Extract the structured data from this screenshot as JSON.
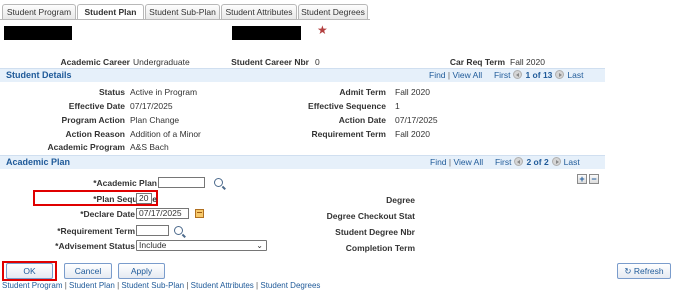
{
  "tabs": [
    {
      "label": "Student Program",
      "active": false
    },
    {
      "label": "Student Plan",
      "active": true
    },
    {
      "label": "Student Sub-Plan",
      "active": false
    },
    {
      "label": "Student Attributes",
      "active": false
    },
    {
      "label": "Student Degrees",
      "active": false
    }
  ],
  "header": {
    "required_marker": "★",
    "academic_career_label": "Academic Career",
    "academic_career_value": "Undergraduate",
    "student_career_nbr_label": "Student Career Nbr",
    "student_career_nbr_value": "0",
    "car_req_term_label": "Car Req Term",
    "car_req_term_value": "Fall 2020"
  },
  "student_details": {
    "title": "Student Details",
    "nav": {
      "find": "Find",
      "view_all": "View All",
      "first": "First",
      "count": "1 of 13",
      "last": "Last"
    },
    "status_label": "Status",
    "status_value": "Active in Program",
    "effective_date_label": "Effective Date",
    "effective_date_value": "07/17/2025",
    "program_action_label": "Program Action",
    "program_action_value": "Plan Change",
    "action_reason_label": "Action Reason",
    "action_reason_value": "Addition of a Minor",
    "academic_program_label": "Academic Program",
    "academic_program_value": "A&S Bach",
    "admit_term_label": "Admit Term",
    "admit_term_value": "Fall 2020",
    "effective_sequence_label": "Effective Sequence",
    "effective_sequence_value": "1",
    "action_date_label": "Action Date",
    "action_date_value": "07/17/2025",
    "requirement_term_label": "Requirement Term",
    "requirement_term_value": "Fall 2020"
  },
  "academic_plan": {
    "title": "Academic Plan",
    "nav": {
      "find": "Find",
      "view_all": "View All",
      "first": "First",
      "count": "2 of 2",
      "last": "Last"
    },
    "add_label": "+",
    "remove_label": "−",
    "academic_plan_label": "*Academic Plan",
    "academic_plan_value": "",
    "plan_sequence_label": "*Plan Sequence",
    "plan_sequence_value": "20",
    "declare_date_label": "*Declare Date",
    "declare_date_value": "07/17/2025",
    "requirement_term_label": "*Requirement Term",
    "requirement_term_value": "",
    "advisement_status_label": "*Advisement Status",
    "advisement_status_value": "Include",
    "degree_label": "Degree",
    "degree_checkout_label": "Degree Checkout Stat",
    "student_degree_nbr_label": "Student Degree Nbr",
    "completion_term_label": "Completion Term"
  },
  "actions": {
    "ok": "OK",
    "cancel": "Cancel",
    "apply": "Apply",
    "refresh": "Refresh"
  },
  "bottom_links": [
    "Student Program",
    "Student Plan",
    "Student Sub-Plan",
    "Student Attributes",
    "Student Degrees"
  ],
  "colors": {
    "link": "#1f5a99",
    "section_bg": "#e6f0fa",
    "highlight": "#e00000"
  }
}
